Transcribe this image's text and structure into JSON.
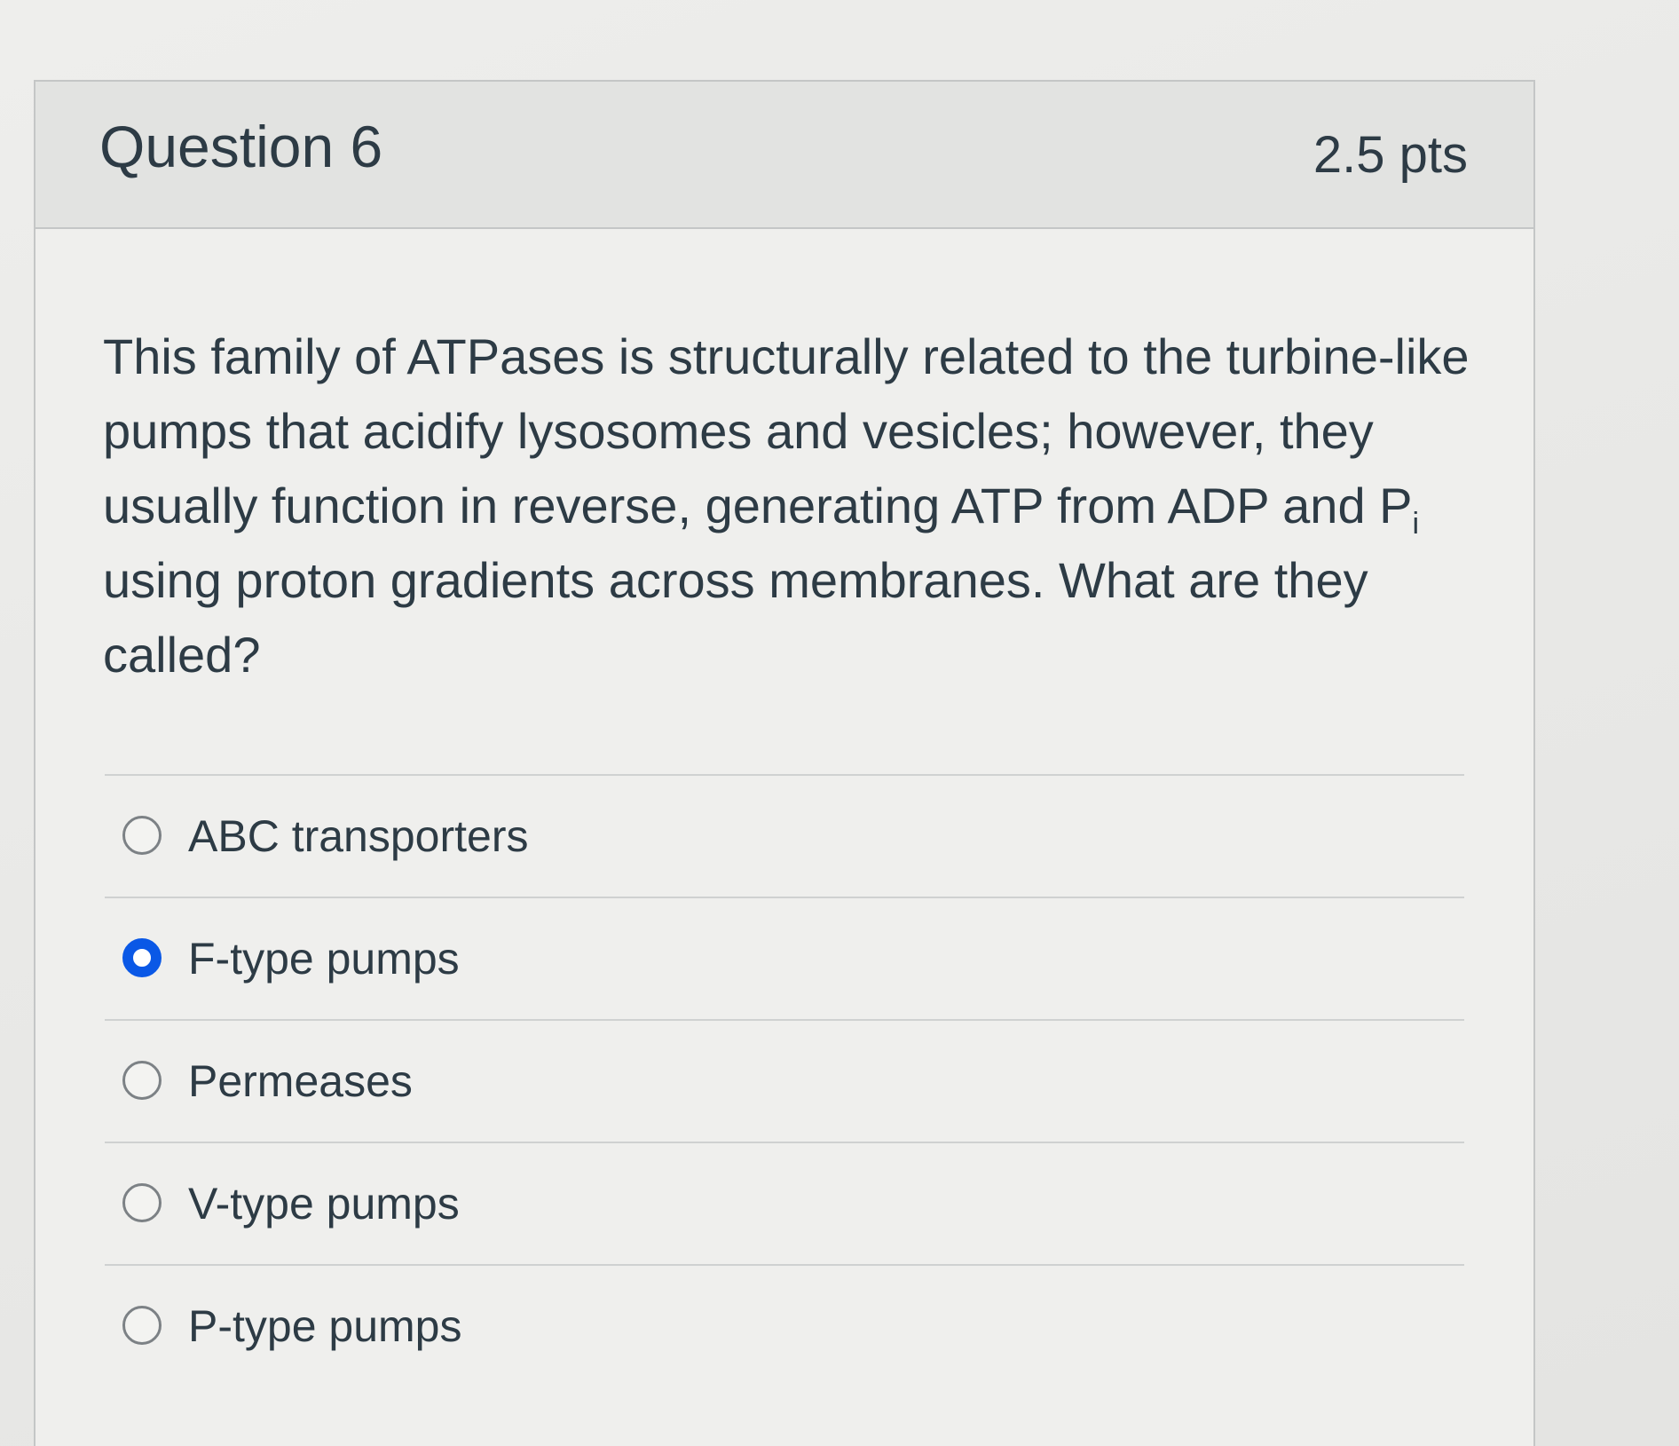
{
  "question": {
    "title": "Question 6",
    "points": "2.5 pts",
    "text_main": "This family of ATPases is structurally related to the turbine-like pumps that acidify lysosomes and vesicles; however, they usually function in reverse, generating ATP from ADP and P",
    "text_subscript": "i",
    "text_end": " using proton gradients across membranes. What are they called?"
  },
  "answers": [
    {
      "label": "ABC transporters",
      "selected": false
    },
    {
      "label": "F-type pumps",
      "selected": true
    },
    {
      "label": "Permeases",
      "selected": false
    },
    {
      "label": "V-type pumps",
      "selected": false
    },
    {
      "label": "P-type pumps",
      "selected": false
    }
  ],
  "colors": {
    "radio_selected": "#0a58e6",
    "text": "#2d3b45"
  }
}
